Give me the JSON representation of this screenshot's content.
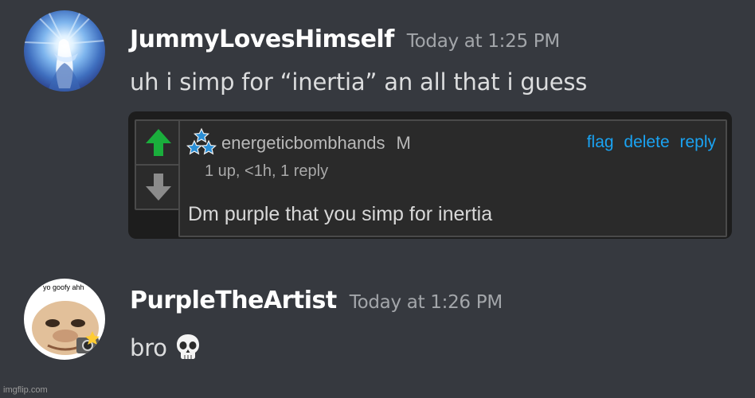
{
  "messages": [
    {
      "username": "JummyLovesHimself",
      "timestamp": "Today at 1:25 PM",
      "content": "uh i simp for “inertia” an all that i guess",
      "avatar": "avatar-glowing-figure"
    },
    {
      "username": "PurpleTheArtist",
      "timestamp": "Today at 1:26 PM",
      "content": "bro",
      "emoji": "skull-emoji",
      "avatar": "avatar-goofy-face",
      "avatar_caption": "yo goofy ahh"
    }
  ],
  "embed": {
    "comment_username": "energeticbombhands",
    "comment_flag": "M",
    "actions": [
      "flag",
      "delete",
      "reply"
    ],
    "meta": "1 up, <1h, 1 reply",
    "text": "Dm purple that you simp for inertia",
    "upvote_color": "#1aae3c",
    "downvote_color": "#8b8b8b"
  },
  "watermark": "imgflip.com",
  "colors": {
    "background": "#36393f",
    "username": "#ffffff",
    "timestamp": "#a3a6aa",
    "text": "#dcddde",
    "link": "#1aa3f2"
  }
}
